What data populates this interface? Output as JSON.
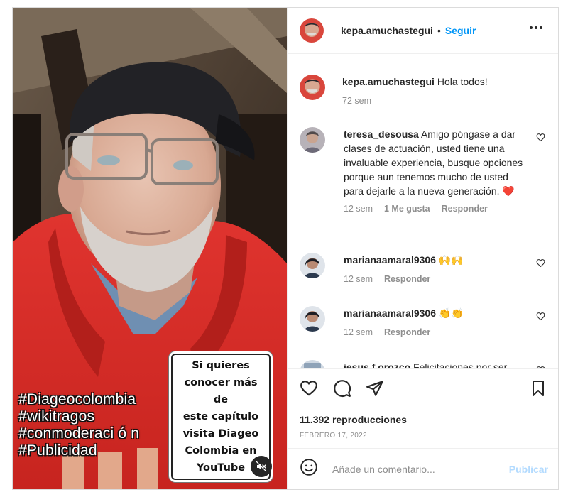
{
  "media": {
    "hashtags": [
      "#Diageocolombia",
      "#wikitragos",
      "#conmoderaci ó n",
      "#Publicidad"
    ],
    "promo_lines": [
      "Si quieres",
      "conocer más de",
      "este capítulo",
      "visita Diageo",
      "Colombia en",
      "YouTube"
    ],
    "mute_icon": "speaker-muted-icon"
  },
  "header": {
    "username": "kepa.amuchastegui",
    "separator": "•",
    "follow_label": "Seguir",
    "more_icon": "three-dots-icon"
  },
  "caption": {
    "username": "kepa.amuchastegui",
    "text": "Hola todos!",
    "time": "72 sem"
  },
  "comments": [
    {
      "username": "teresa_desousa",
      "text": "Amigo póngase a dar clases de actuación, usted tiene una invaluable experiencia, busque opciones porque aun tenemos mucho de usted para dejarle a la nueva generación.",
      "emoji": "❤️",
      "time": "12 sem",
      "likes": "1 Me gusta",
      "reply": "Responder"
    },
    {
      "username": "marianaamaral9306",
      "text": "",
      "emoji": "🙌🙌",
      "time": "12 sem",
      "reply": "Responder"
    },
    {
      "username": "marianaamaral9306",
      "text": "",
      "emoji": "👏👏",
      "time": "12 sem",
      "reply": "Responder"
    },
    {
      "username": "jesus.f.orozco",
      "text": "Felicitaciones por ser",
      "emoji": ""
    }
  ],
  "actions": {
    "views": "11.392 reproducciones",
    "date": "FEBRERO 17, 2022"
  },
  "add_comment": {
    "placeholder": "Añade un comentario...",
    "publish_label": "Publicar"
  },
  "colors": {
    "link_blue": "#0095f6",
    "publish_disabled": "#b3dbff",
    "heart_red": "#ed4956",
    "hoodie_red": "#d42b2b",
    "muted_text": "#8e8e8e"
  }
}
